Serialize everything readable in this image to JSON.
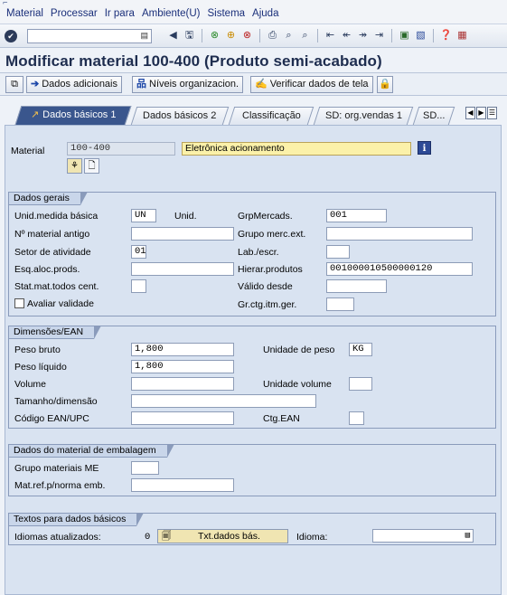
{
  "menu": {
    "glyph": "⌐",
    "items": [
      "Material",
      "Processar",
      "Ir para",
      "Ambiente(U)",
      "Sistema",
      "Ajuda"
    ]
  },
  "toolbar": {
    "command_value": "",
    "icons": [
      "check-icon",
      "back-icon",
      "save-icon",
      "green-arrow-icon",
      "exit-icon",
      "cancel-icon",
      "print-icon",
      "find-icon",
      "find-next-icon",
      "first-page-icon",
      "prev-page-icon",
      "next-page-icon",
      "last-page-icon",
      "new-session-icon",
      "shortcut-icon",
      "help-icon",
      "layout-icon"
    ]
  },
  "title": "Modificar material 100-400 (Produto semi-acabado)",
  "app_toolbar": {
    "buttons": [
      "Dados adicionais",
      "Níveis organizacion.",
      "Verificar dados de tela"
    ]
  },
  "tabs": [
    "Dados básicos 1",
    "Dados básicos 2",
    "Classificação",
    "SD: org.vendas 1",
    "SD..."
  ],
  "material": {
    "label": "Material",
    "number": "100-400",
    "description": "Eletrônica acionamento"
  },
  "dados_gerais": {
    "title": "Dados gerais",
    "unid_medida_label": "Unid.medida básica",
    "unid_medida_value": "UN",
    "unid_label": "Unid.",
    "grp_mercads_label": "GrpMercads.",
    "grp_mercads_value": "001",
    "material_antigo_label": "Nº material antigo",
    "material_antigo_value": "",
    "grupo_merc_ext_label": "Grupo merc.ext.",
    "grupo_merc_ext_value": "",
    "setor_label": "Setor de atividade",
    "setor_value": "01",
    "lab_escr_label": "Lab./escr.",
    "lab_escr_value": "",
    "esq_aloc_label": "Esq.aloc.prods.",
    "esq_aloc_value": "",
    "hierar_label": "Hierar.produtos",
    "hierar_value": "001000010500000120",
    "stat_mat_label": "Stat.mat.todos cent.",
    "stat_mat_value": "",
    "valido_label": "Válido desde",
    "valido_value": "",
    "gr_ctg_label": "Gr.ctg.itm.ger.",
    "gr_ctg_value": "",
    "avaliar_label": "Avaliar validade"
  },
  "dimensoes": {
    "title": "Dimensões/EAN",
    "peso_bruto_label": "Peso bruto",
    "peso_bruto_value": "1,800",
    "unidade_peso_label": "Unidade de peso",
    "unidade_peso_value": "KG",
    "peso_liquido_label": "Peso líquido",
    "peso_liquido_value": "1,800",
    "volume_label": "Volume",
    "volume_value": "",
    "unidade_volume_label": "Unidade volume",
    "unidade_volume_value": "",
    "tamanho_label": "Tamanho/dimensão",
    "tamanho_value": "",
    "ean_label": "Código EAN/UPC",
    "ean_value": "",
    "ctg_ean_label": "Ctg.EAN",
    "ctg_ean_value": ""
  },
  "embalagem": {
    "title": "Dados do material de embalagem",
    "grupo_label": "Grupo materiais ME",
    "grupo_value": "",
    "mat_ref_label": "Mat.ref.p/norma emb.",
    "mat_ref_value": ""
  },
  "textos": {
    "title": "Textos para dados básicos",
    "idiomas_label": "Idiomas atualizados:",
    "idiomas_count": "0",
    "txt_button": "Txt.dados bás.",
    "idioma_label": "Idioma:",
    "idioma_value": ""
  },
  "colors": {
    "title": "#1e2d4f",
    "active_tab": "#3a568d",
    "panel": "#d9e3f1",
    "description_field": "#fbf1a9"
  }
}
